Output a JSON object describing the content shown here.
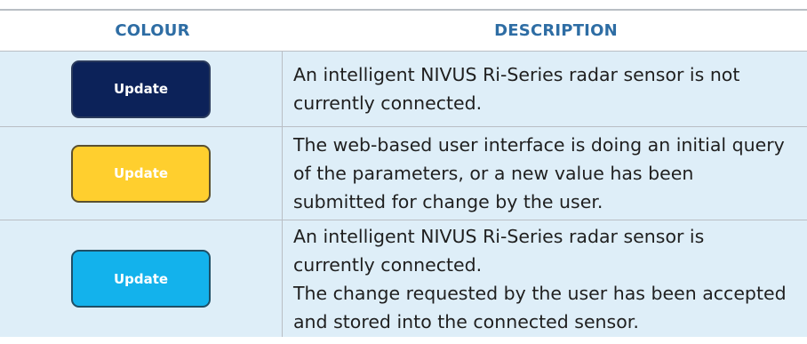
{
  "header": {
    "colour": "COLOUR",
    "description": "DESCRIPTION"
  },
  "rows": [
    {
      "button_label": "Update",
      "button_color": "#0c2259",
      "description": [
        "An intelligent NIVUS Ri-Series radar sensor is not currently connected."
      ]
    },
    {
      "button_label": "Update",
      "button_color": "#ffcf2e",
      "description": [
        "The web-based user interface is doing an initial query of the parameters, or a new value has been submitted for change by the user."
      ]
    },
    {
      "button_label": "Update",
      "button_color": "#13b2ec",
      "description": [
        "An intelligent NIVUS Ri-Series radar sensor is currently connected.",
        "The change requested by the user has been accepted and stored into the connected sensor."
      ]
    }
  ],
  "colors": {
    "header_text": "#2e6da4",
    "row_background": "#deeef8",
    "rule": "#b9bec4"
  }
}
